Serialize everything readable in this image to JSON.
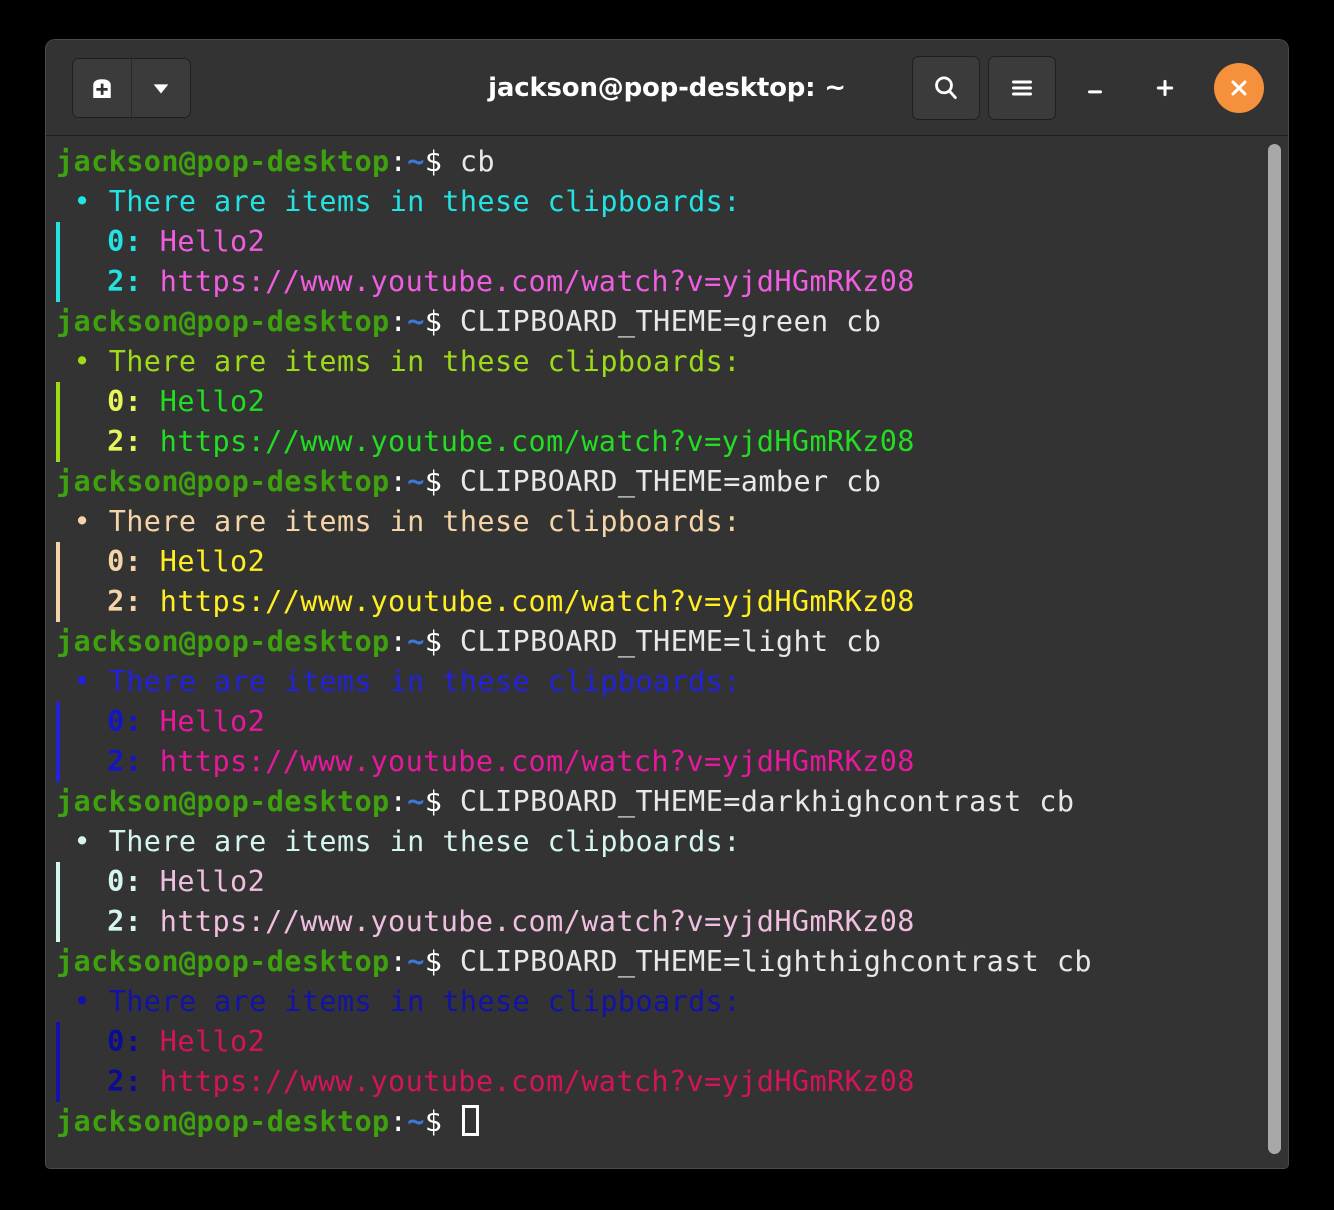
{
  "window": {
    "title": "jackson@pop-desktop: ~",
    "titlebar": {
      "new_tab_label": "new-tab-icon",
      "tab_menu_label": "chevron-down-icon",
      "search_label": "search-icon",
      "menu_label": "hamburger-menu-icon",
      "minimize_label": "–",
      "maximize_label": "+",
      "close_label": "✕"
    }
  },
  "colors": {
    "window_bg": "#323232",
    "terminal_bg": "#333333",
    "titlebar_bg": "#333333",
    "close_button": "#f5903d",
    "prompt_user": "#3fa10e",
    "prompt_tilde": "#3b78d8",
    "command_text": "#e8e8e8",
    "scrollbar_thumb": "#a8a8a8"
  },
  "prompt": {
    "user_host": "jackson@pop-desktop",
    "colon": ":",
    "path": "~",
    "symbol": "$"
  },
  "terminal": {
    "header_text": "There are items in these clipboards:",
    "bullet": "•",
    "blocks": [
      {
        "command": "cb",
        "theme_name": "default",
        "header_color": "#22e2e2",
        "bar_color": "#22e2e2",
        "bullet_color": "#22e2e2",
        "index_color": "#22e2e2",
        "value_color": "#f05de0",
        "items": [
          {
            "index": "0:",
            "value": "Hello2"
          },
          {
            "index": "2:",
            "value": "https://www.youtube.com/watch?v=yjdHGmRKz08"
          }
        ]
      },
      {
        "command": "CLIPBOARD_THEME=green cb",
        "theme_name": "green",
        "header_color": "#9ddb17",
        "bar_color": "#9ddb17",
        "bullet_color": "#9ddb17",
        "index_color": "#e8f55a",
        "value_color": "#22dd22",
        "items": [
          {
            "index": "0:",
            "value": "Hello2"
          },
          {
            "index": "2:",
            "value": "https://www.youtube.com/watch?v=yjdHGmRKz08"
          }
        ]
      },
      {
        "command": "CLIPBOARD_THEME=amber cb",
        "theme_name": "amber",
        "header_color": "#f5d5a8",
        "bar_color": "#f5d5a8",
        "bullet_color": "#f5d5a8",
        "index_color": "#f5d5a8",
        "value_color": "#ffee22",
        "items": [
          {
            "index": "0:",
            "value": "Hello2"
          },
          {
            "index": "2:",
            "value": "https://www.youtube.com/watch?v=yjdHGmRKz08"
          }
        ]
      },
      {
        "command": "CLIPBOARD_THEME=light cb",
        "theme_name": "light",
        "header_color": "#2222dd",
        "bar_color": "#2222dd",
        "bullet_color": "#2222dd",
        "index_color": "#1414c8",
        "value_color": "#e6189b",
        "items": [
          {
            "index": "0:",
            "value": "Hello2"
          },
          {
            "index": "2:",
            "value": "https://www.youtube.com/watch?v=yjdHGmRKz08"
          }
        ]
      },
      {
        "command": "CLIPBOARD_THEME=darkhighcontrast cb",
        "theme_name": "darkhighcontrast",
        "header_color": "#d5f5f0",
        "bar_color": "#d5f5f0",
        "bullet_color": "#d5f5f0",
        "index_color": "#d5f5f0",
        "value_color": "#f0bfe0",
        "items": [
          {
            "index": "0:",
            "value": "Hello2"
          },
          {
            "index": "2:",
            "value": "https://www.youtube.com/watch?v=yjdHGmRKz08"
          }
        ]
      },
      {
        "command": "CLIPBOARD_THEME=lighthighcontrast cb",
        "theme_name": "lighthighcontrast",
        "header_color": "#1212a8",
        "bar_color": "#1212a8",
        "bullet_color": "#1212a8",
        "index_color": "#0b0b96",
        "value_color": "#d4145a",
        "items": [
          {
            "index": "0:",
            "value": "Hello2"
          },
          {
            "index": "2:",
            "value": "https://www.youtube.com/watch?v=yjdHGmRKz08"
          }
        ]
      }
    ],
    "final_prompt": {
      "cursor": true
    }
  }
}
